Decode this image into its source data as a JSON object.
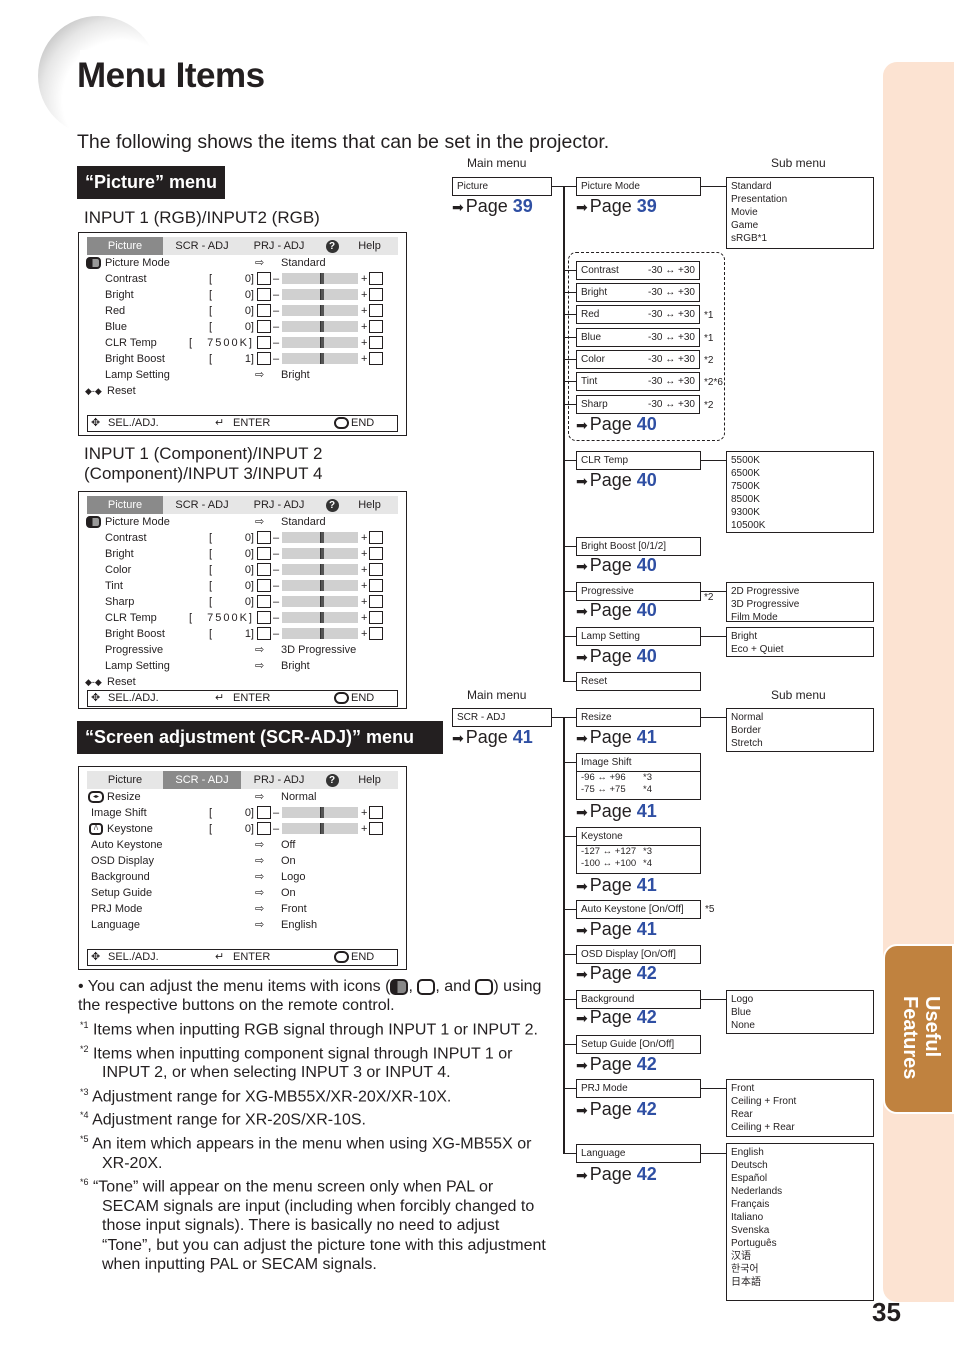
{
  "page": {
    "title": "Menu Items",
    "intro": "The following shows the items that can be set in the projector.",
    "page_number": "35",
    "side_tab": "Useful Features",
    "side_tab_line1": "Useful",
    "side_tab_line2": "Features"
  },
  "sections": {
    "picture_menu": "“Picture” menu",
    "scr_menu": "“Screen adjustment (SCR-ADJ)” menu"
  },
  "osd_common": {
    "tabs": [
      "Picture",
      "SCR - ADJ",
      "PRJ - ADJ",
      "?",
      "Help"
    ],
    "footer": {
      "sel": "SEL./ADJ.",
      "enter": "ENTER",
      "end": "END"
    }
  },
  "osd1": {
    "label": "INPUT 1 (RGB)/INPUT2 (RGB)",
    "active_tab": "Picture",
    "rows": [
      {
        "name": "Picture Mode",
        "value": "Standard",
        "type": "option"
      },
      {
        "name": "Contrast",
        "value": "0",
        "type": "slider",
        "level": 0.5
      },
      {
        "name": "Bright",
        "value": "0",
        "type": "slider",
        "level": 0.5
      },
      {
        "name": "Red",
        "value": "0",
        "type": "slider",
        "level": 0.5
      },
      {
        "name": "Blue",
        "value": "0",
        "type": "slider",
        "level": 0.5
      },
      {
        "name": "CLR Temp",
        "value": "7500K",
        "type": "slider",
        "level": 0.5
      },
      {
        "name": "Bright Boost",
        "value": "1",
        "type": "slider",
        "level": 0.5
      },
      {
        "name": "Lamp Setting",
        "value": "Bright",
        "type": "option"
      },
      {
        "name": "Reset",
        "value": "",
        "type": "action"
      }
    ]
  },
  "osd2": {
    "label_line1": "INPUT 1 (Component)/INPUT 2",
    "label_line2": "(Component)/INPUT 3/INPUT 4",
    "active_tab": "Picture",
    "rows": [
      {
        "name": "Picture Mode",
        "value": "Standard",
        "type": "option"
      },
      {
        "name": "Contrast",
        "value": "0",
        "type": "slider",
        "level": 0.5
      },
      {
        "name": "Bright",
        "value": "0",
        "type": "slider",
        "level": 0.5
      },
      {
        "name": "Color",
        "value": "0",
        "type": "slider",
        "level": 0.5
      },
      {
        "name": "Tint",
        "value": "0",
        "type": "slider",
        "level": 0.5
      },
      {
        "name": "Sharp",
        "value": "0",
        "type": "slider",
        "level": 0.5
      },
      {
        "name": "CLR Temp",
        "value": "7500K",
        "type": "slider",
        "level": 0.5
      },
      {
        "name": "Bright Boost",
        "value": "1",
        "type": "slider",
        "level": 0.5
      },
      {
        "name": "Progressive",
        "value": "3D Progressive",
        "type": "option"
      },
      {
        "name": "Lamp Setting",
        "value": "Bright",
        "type": "option"
      },
      {
        "name": "Reset",
        "value": "",
        "type": "action"
      }
    ]
  },
  "osd3": {
    "active_tab": "SCR - ADJ",
    "rows": [
      {
        "name": "Resize",
        "value": "Normal",
        "type": "option"
      },
      {
        "name": "Image Shift",
        "value": "0",
        "type": "slider",
        "level": 0.5
      },
      {
        "name": "Keystone",
        "value": "0",
        "type": "slider",
        "level": 0.5
      },
      {
        "name": "Auto Keystone",
        "value": "Off",
        "type": "option"
      },
      {
        "name": "OSD Display",
        "value": "On",
        "type": "option"
      },
      {
        "name": "Background",
        "value": "Logo",
        "type": "option"
      },
      {
        "name": "Setup Guide",
        "value": "On",
        "type": "option"
      },
      {
        "name": "PRJ Mode",
        "value": "Front",
        "type": "option"
      },
      {
        "name": "Language",
        "value": "English",
        "type": "option"
      }
    ]
  },
  "tree_labels": {
    "main_menu": "Main menu",
    "sub_menu": "Sub menu",
    "page_word": "Page"
  },
  "picture_tree": {
    "main": {
      "label": "Picture",
      "page": "39"
    },
    "items": [
      {
        "label": "Picture Mode",
        "page": "39",
        "sub": [
          "Standard",
          "Presentation",
          "Movie",
          "Game",
          "sRGB*1"
        ]
      },
      {
        "label": "Contrast",
        "range": "-30 ↔ +30",
        "note": ""
      },
      {
        "label": "Bright",
        "range": "-30 ↔ +30",
        "note": ""
      },
      {
        "label": "Red",
        "range": "-30 ↔ +30",
        "note": "*1"
      },
      {
        "label": "Blue",
        "range": "-30 ↔ +30",
        "note": "*1"
      },
      {
        "label": "Color",
        "range": "-30 ↔ +30",
        "note": "*2"
      },
      {
        "label": "Tint",
        "range": "-30 ↔ +30",
        "note": "*2*6"
      },
      {
        "label": "Sharp",
        "range": "-30 ↔ +30",
        "note": "*2"
      },
      {
        "label": "CLR Temp",
        "page": "40",
        "sub": [
          "5500K",
          "6500K",
          "7500K",
          "8500K",
          "9300K",
          "10500K"
        ]
      },
      {
        "label": "Bright Boost [0/1/2]",
        "page": "40"
      },
      {
        "label": "Progressive",
        "page": "40",
        "note": "*2",
        "sub": [
          "2D Progressive",
          "3D Progressive",
          "Film Mode"
        ]
      },
      {
        "label": "Lamp Setting",
        "page": "40",
        "sub": [
          "Bright",
          "Eco + Quiet"
        ]
      },
      {
        "label": "Reset"
      }
    ],
    "adjust_group_page": "40"
  },
  "scr_tree": {
    "main": {
      "label": "SCR - ADJ",
      "page": "41"
    },
    "items": [
      {
        "label": "Resize",
        "page": "41",
        "sub": [
          "Normal",
          "Border",
          "Stretch"
        ]
      },
      {
        "label": "Image Shift",
        "ranges": [
          {
            "r": "-96 ↔ +96",
            "n": "*3"
          },
          {
            "r": "-75 ↔ +75",
            "n": "*4"
          }
        ],
        "page": "41"
      },
      {
        "label": "Keystone",
        "ranges": [
          {
            "r": "-127 ↔ +127",
            "n": "*3"
          },
          {
            "r": "-100 ↔ +100",
            "n": "*4"
          }
        ],
        "page": "41"
      },
      {
        "label": "Auto Keystone [On/Off]",
        "note": "*5",
        "page": "41"
      },
      {
        "label": "OSD Display [On/Off]",
        "page": "42"
      },
      {
        "label": "Background",
        "page": "42",
        "sub": [
          "Logo",
          "Blue",
          "None"
        ]
      },
      {
        "label": "Setup Guide [On/Off]",
        "page": "42"
      },
      {
        "label": "PRJ Mode",
        "page": "42",
        "sub": [
          "Front",
          "Ceiling + Front",
          "Rear",
          "Ceiling + Rear"
        ]
      },
      {
        "label": "Language",
        "page": "42",
        "sub": [
          "English",
          "Deutsch",
          "Español",
          "Nederlands",
          "Français",
          "Italiano",
          "Svenska",
          "Português",
          "汉语",
          "한국어",
          "日本語"
        ]
      }
    ]
  },
  "notes": {
    "bullet_a": "• You can adjust the menu items with icons (",
    "bullet_b": ",",
    "bullet_c": ", and",
    "bullet_d": ") using the respective buttons on the remote control.",
    "footnotes": [
      {
        "mark": "*1",
        "text": "Items when inputting RGB signal through INPUT 1 or INPUT 2."
      },
      {
        "mark": "*2",
        "text": "Items when inputting component signal through INPUT 1 or INPUT 2, or when selecting INPUT 3 or INPUT 4."
      },
      {
        "mark": "*3",
        "text": "Adjustment range for XG-MB55X/XR-20X/XR-10X."
      },
      {
        "mark": "*4",
        "text": "Adjustment range for XR-20S/XR-10S."
      },
      {
        "mark": "*5",
        "text": "An item which appears in the menu when using XG-MB55X or XR-20X."
      },
      {
        "mark": "*6",
        "text": "“Tone” will appear on the menu screen only when PAL or SECAM signals are input (including when forcibly changed to those input signals). There is basically no need to adjust “Tone”, but you can adjust the picture tone with this adjustment when inputting PAL or SECAM signals."
      }
    ]
  },
  "colors": {
    "accent_blue": "#2f4fa3",
    "tab_brown": "#c0823f",
    "sidebar_peach": "#fce3d2"
  }
}
